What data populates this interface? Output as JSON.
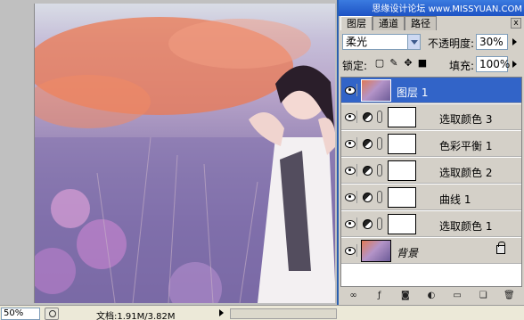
{
  "canvas": {
    "description_alt": "photo"
  },
  "status": {
    "zoom": "50%",
    "doc_size": "文档:1.91M/3.82M"
  },
  "panel": {
    "watermark": "思缘设计论坛 www.MISSYUAN.COM",
    "tabs": [
      "图层",
      "通道",
      "路径"
    ],
    "close": "x",
    "blend_mode": "柔光",
    "opacity_label": "不透明度:",
    "opacity_value": "30%",
    "lock_label": "锁定:",
    "fill_label": "填充:",
    "fill_value": "100%",
    "layers": [
      {
        "name": "图层 1",
        "kind": "pixel",
        "selected": true
      },
      {
        "name": "选取颜色 3",
        "kind": "adjustment"
      },
      {
        "name": "色彩平衡 1",
        "kind": "adjustment"
      },
      {
        "name": "选取颜色 2",
        "kind": "adjustment"
      },
      {
        "name": "曲线 1",
        "kind": "adjustment"
      },
      {
        "name": "选取颜色 1",
        "kind": "adjustment"
      },
      {
        "name": "背景",
        "kind": "background",
        "locked": true
      }
    ],
    "footer_icons": [
      "link-icon",
      "fx-icon",
      "mask-icon",
      "adjustment-icon",
      "group-icon",
      "new-layer-icon",
      "trash-icon"
    ]
  },
  "colors": {
    "selection": "#3264c8",
    "panel_bg": "#d4d0c8",
    "titlebar": "#1d52c4"
  }
}
